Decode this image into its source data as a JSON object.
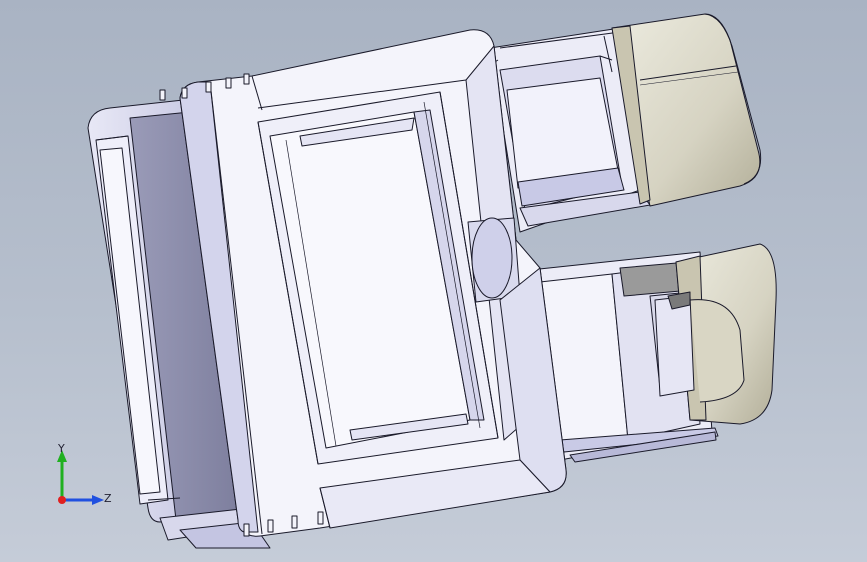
{
  "triad": {
    "y_label": "Y",
    "z_label": "Z",
    "colors": {
      "x": "#e02020",
      "y": "#20b020",
      "z": "#2050e0"
    }
  },
  "colors": {
    "background": "#b6bfcd",
    "part_light": "#f4f4fb",
    "part_shade": "#c9cbe6",
    "part_dark": "#8e8fb0",
    "edge": "#1a1a2a",
    "cap": "#ddd9c8",
    "cap_shade": "#b8b4a0"
  }
}
